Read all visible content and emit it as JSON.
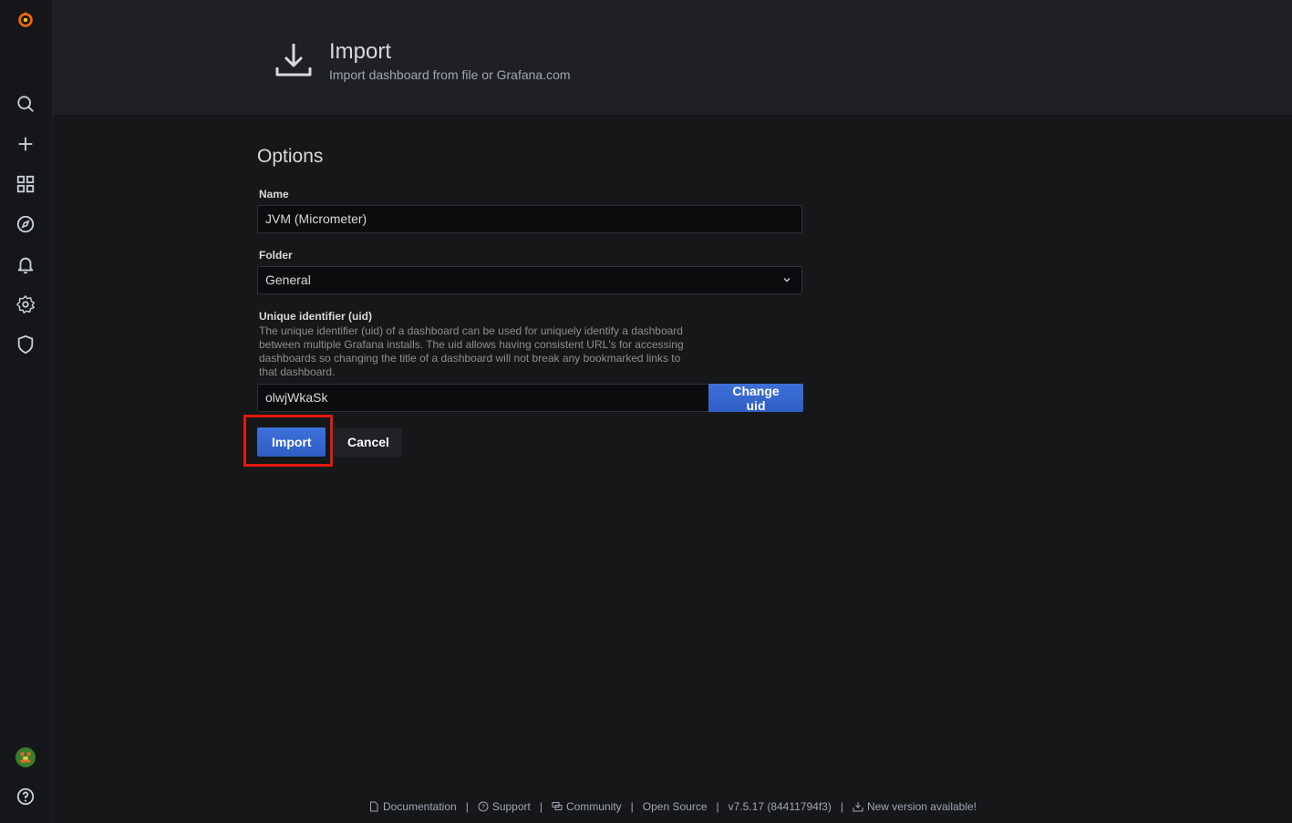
{
  "header": {
    "title": "Import",
    "subtitle": "Import dashboard from file or Grafana.com"
  },
  "options": {
    "section_title": "Options",
    "name_label": "Name",
    "name_value": "JVM (Micrometer)",
    "folder_label": "Folder",
    "folder_value": "General",
    "uid_label": "Unique identifier (uid)",
    "uid_description": "The unique identifier (uid) of a dashboard can be used for uniquely identify a dashboard between multiple Grafana installs. The uid allows having consistent URL's for accessing dashboards so changing the title of a dashboard will not break any bookmarked links to that dashboard.",
    "uid_value": "olwjWkaSk",
    "change_uid_label": "Change uid",
    "import_label": "Import",
    "cancel_label": "Cancel"
  },
  "sidebar": {
    "icons": [
      "grafana-logo-icon",
      "search-icon",
      "plus-icon",
      "dashboards-icon",
      "explore-compass-icon",
      "alerting-bell-icon",
      "configuration-gear-icon",
      "server-admin-shield-icon",
      "user-avatar",
      "help-icon"
    ]
  },
  "footer": {
    "documentation": "Documentation",
    "support": "Support",
    "community": "Community",
    "open_source": "Open Source",
    "version": "v7.5.17 (84411794f3)",
    "new_version": "New version available!",
    "separator": "|"
  },
  "colors": {
    "primary": "#3d71d9",
    "highlight": "#e0190a",
    "logo": "#f46800"
  }
}
